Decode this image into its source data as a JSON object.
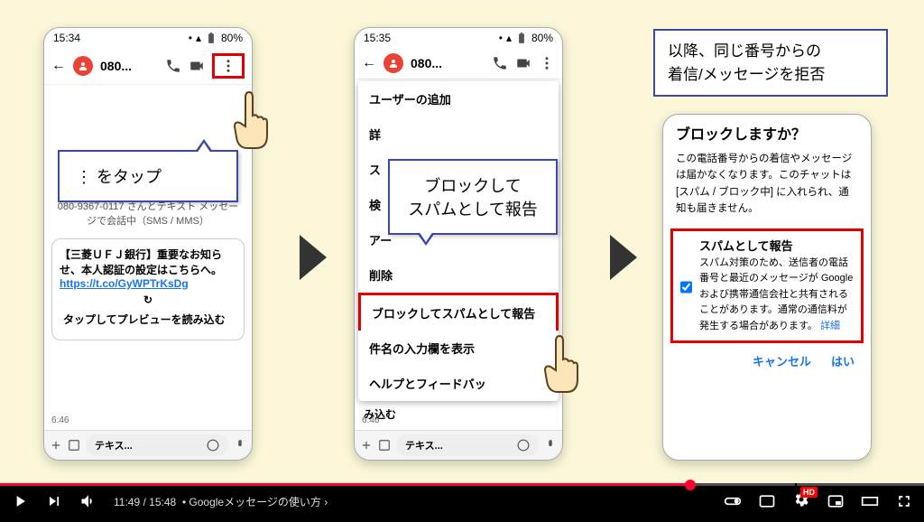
{
  "status": {
    "time1": "15:34",
    "time2": "15:35",
    "battery": "80%"
  },
  "header": {
    "contact": "080...",
    "back": "←"
  },
  "phone1": {
    "conversation_note": "080-9367-0117 さんとテキスト メッセージで会話中（SMS / MMS）",
    "message": "【三菱ＵＦＪ銀行】重要なお知らせ、本人認証の設定はこちらへ。",
    "link": "https://t.co/GyWPTrKsDg",
    "preview": "タップしてプレビューを読み込む",
    "timestamp": "6:46",
    "input_placeholder": "テキス..."
  },
  "callout1": "⋮ をタップ",
  "menu": {
    "items": [
      "ユーザーの追加",
      "詳",
      "ス",
      "検",
      "アー",
      "削除",
      "ブロックしてスパムとして報告",
      "件名の入力欄を表示",
      "ヘルプとフィードバッ"
    ]
  },
  "callout2_line1": "ブロックして",
  "callout2_line2": "スパムとして報告",
  "phone2_bottom": "み込む",
  "top_annotation_line1": "以降、同じ番号からの",
  "top_annotation_line2": "着信/メッセージを拒否",
  "dialog": {
    "title": "ブロックしますか？",
    "body": "この電話番号からの着信やメッセージは届かなくなります。このチャットは [スパム / ブロック中] に入れられ、通知も届きません。",
    "checkbox_title": "スパムとして報告",
    "checkbox_body": "スパム対策のため、送信者の電話番号と最近のメッセージが Google および携帯通信会社と共有されることがあります。通常の通信料が発生する場合があります。",
    "detail_link": "詳細",
    "cancel": "キャンセル",
    "ok": "はい"
  },
  "video": {
    "current": "11:49",
    "total": "15:48",
    "title": "Googleメッセージの使い方",
    "hd": "HD"
  }
}
